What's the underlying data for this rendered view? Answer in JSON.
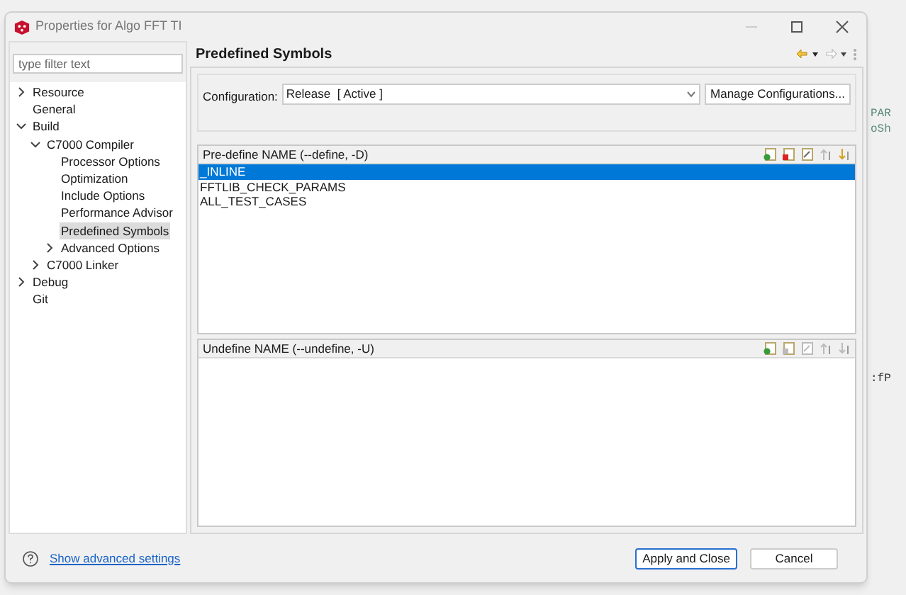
{
  "window": {
    "title": "Properties for Algo FFT TI"
  },
  "filter": {
    "placeholder": "type filter text"
  },
  "tree": [
    {
      "label": "Resource",
      "kind": "folder",
      "expanded": false,
      "selected": false
    },
    {
      "label": "General",
      "kind": "leaf",
      "selected": false
    },
    {
      "label": "Build",
      "kind": "folder",
      "expanded": true,
      "selected": false,
      "children": [
        {
          "label": "C7000 Compiler",
          "kind": "folder",
          "expanded": true,
          "selected": false,
          "children": [
            {
              "label": "Processor Options",
              "kind": "leaf",
              "selected": false
            },
            {
              "label": "Optimization",
              "kind": "leaf",
              "selected": false
            },
            {
              "label": "Include Options",
              "kind": "leaf",
              "selected": false
            },
            {
              "label": "Performance Advisor",
              "kind": "leaf",
              "selected": false
            },
            {
              "label": "Predefined Symbols",
              "kind": "leaf",
              "selected": true
            },
            {
              "label": "Advanced Options",
              "kind": "folder",
              "expanded": false,
              "selected": false
            }
          ]
        },
        {
          "label": "C7000 Linker",
          "kind": "folder",
          "expanded": false,
          "selected": false
        }
      ]
    },
    {
      "label": "Debug",
      "kind": "folder",
      "expanded": false,
      "selected": false
    },
    {
      "label": "Git",
      "kind": "leaf",
      "selected": false
    }
  ],
  "page": {
    "title": "Predefined Symbols"
  },
  "configuration": {
    "label": "Configuration:",
    "value": "Release  [ Active ]",
    "button": "Manage Configurations..."
  },
  "lists": [
    {
      "title": "Pre-define NAME (--define, -D)",
      "tools": [
        {
          "kind": "add",
          "disabled": false
        },
        {
          "kind": "delete",
          "disabled": false
        },
        {
          "kind": "edit",
          "disabled": false
        },
        {
          "kind": "up",
          "disabled": true
        },
        {
          "kind": "down",
          "disabled": false
        }
      ],
      "items": [
        {
          "label": "_INLINE",
          "selected": true
        },
        {
          "label": "FFTLIB_CHECK_PARAMS",
          "selected": false
        },
        {
          "label": "ALL_TEST_CASES",
          "selected": false
        }
      ]
    },
    {
      "title": "Undefine NAME (--undefine, -U)",
      "tools": [
        {
          "kind": "add",
          "disabled": false
        },
        {
          "kind": "delete",
          "disabled": true
        },
        {
          "kind": "edit",
          "disabled": true
        },
        {
          "kind": "up",
          "disabled": true
        },
        {
          "kind": "down",
          "disabled": true
        }
      ]
    }
  ],
  "footer": {
    "link": "Show advanced settings",
    "buttons": [
      {
        "label": "Apply and Close",
        "default": true
      },
      {
        "label": "Cancel",
        "default": false
      }
    ]
  },
  "background_fragments": [
    "PAR",
    "oSh",
    ":fP"
  ]
}
